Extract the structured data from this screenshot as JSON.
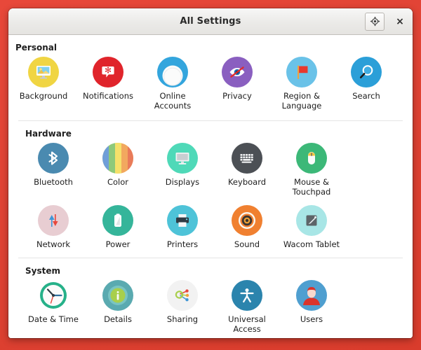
{
  "window": {
    "title": "All Settings",
    "titlebar_buttons": [
      {
        "name": "find-location-button",
        "glyph": "location-icon"
      },
      {
        "name": "close-button",
        "glyph": "×"
      }
    ]
  },
  "colors": {
    "desktop_background": "#dd4132",
    "window_background": "#ffffff",
    "titlebar_background": "#ebeae8",
    "divider": "#e4e4e4",
    "text": "#1d1d1d"
  },
  "sections": [
    {
      "id": "personal",
      "heading": "Personal",
      "items": [
        {
          "label": "Background",
          "icon": "background-icon",
          "bg": "#f0d543"
        },
        {
          "label": "Notifications",
          "icon": "notifications-icon",
          "bg": "#e0242b"
        },
        {
          "label": "Online\nAccounts",
          "icon": "online-accounts-icon",
          "bg": "#33a5dd"
        },
        {
          "label": "Privacy",
          "icon": "privacy-icon",
          "bg": "#8a5fc0"
        },
        {
          "label": "Region &\nLanguage",
          "icon": "region-language-icon",
          "bg": "#6ac2e8"
        },
        {
          "label": "Search",
          "icon": "search-icon",
          "bg": "#2b9fd8"
        }
      ]
    },
    {
      "id": "hardware",
      "heading": "Hardware",
      "items": [
        {
          "label": "Bluetooth",
          "icon": "bluetooth-icon",
          "bg": "#4a8ab0"
        },
        {
          "label": "Color",
          "icon": "color-icon",
          "bg": "#f0d060"
        },
        {
          "label": "Displays",
          "icon": "displays-icon",
          "bg": "#4fd9b8"
        },
        {
          "label": "Keyboard",
          "icon": "keyboard-icon",
          "bg": "#4c5055"
        },
        {
          "label": "Mouse &\nTouchpad",
          "icon": "mouse-touchpad-icon",
          "bg": "#3cb878"
        },
        {
          "label": "Network",
          "icon": "network-icon",
          "bg": "#e8cdd2"
        },
        {
          "label": "Power",
          "icon": "power-icon",
          "bg": "#35b59a"
        },
        {
          "label": "Printers",
          "icon": "printers-icon",
          "bg": "#4ec3d8"
        },
        {
          "label": "Sound",
          "icon": "sound-icon",
          "bg": "#f08030"
        },
        {
          "label": "Wacom Tablet",
          "icon": "wacom-tablet-icon",
          "bg": "#a8e6e6"
        }
      ]
    },
    {
      "id": "system",
      "heading": "System",
      "items": [
        {
          "label": "Date & Time",
          "icon": "date-time-icon",
          "bg": "#ffffff"
        },
        {
          "label": "Details",
          "icon": "details-icon",
          "bg": "#5aaab0"
        },
        {
          "label": "Sharing",
          "icon": "sharing-icon",
          "bg": "#f2f2f2"
        },
        {
          "label": "Universal\nAccess",
          "icon": "universal-access-icon",
          "bg": "#2b84ad"
        },
        {
          "label": "Users",
          "icon": "users-icon",
          "bg": "#4f9fd0"
        }
      ]
    }
  ]
}
